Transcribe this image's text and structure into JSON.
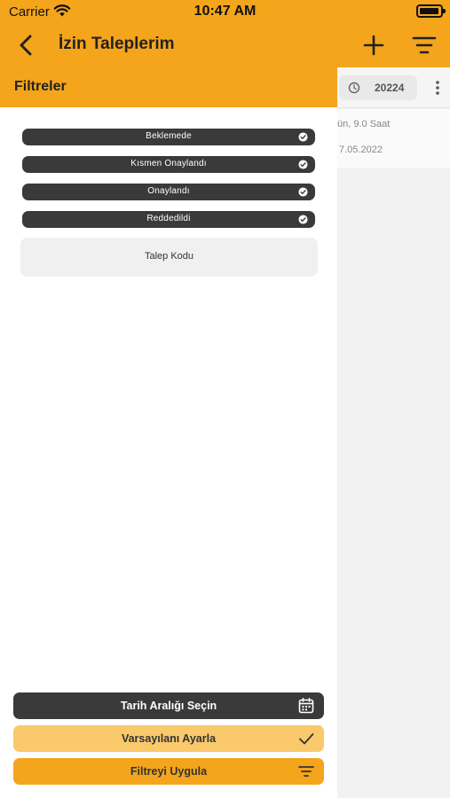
{
  "status_bar": {
    "carrier": "Carrier",
    "time": "10:47 AM"
  },
  "nav": {
    "title": "İzin Taleplerim"
  },
  "drawer": {
    "title": "Filtreler",
    "status_filters": [
      "Beklemede",
      "Kısmen Onaylandı",
      "Onaylandı",
      "Reddedildi"
    ],
    "code_field_label": "Talep Kodu",
    "date_range_button": "Tarih Aralığı Seçin",
    "default_button": "Varsayılanı Ayarla",
    "apply_button": "Filtreyi Uygula"
  },
  "background_list": {
    "chip_value": "20224",
    "duration_text": "ün, 9.0 Saat",
    "date_text": "7.05.2022"
  },
  "colors": {
    "accent": "#f4a51c",
    "accent_light": "#f9c96b",
    "dark": "#3a3a3a"
  },
  "icons": {
    "back": "chevron-left-icon",
    "add": "plus-icon",
    "filter": "filter-lines-icon",
    "check": "check-circle-icon",
    "calendar": "calendar-icon",
    "checkmark": "checkmark-icon",
    "clock": "clock-icon",
    "more": "more-vertical-icon"
  }
}
